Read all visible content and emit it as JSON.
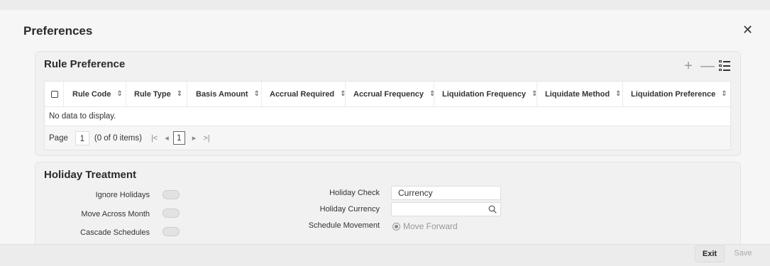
{
  "dialog": {
    "title": "Preferences",
    "close_glyph": "✕"
  },
  "rule_preference": {
    "title": "Rule Preference",
    "tools": {
      "add": "+",
      "remove": "—"
    },
    "columns": [
      "Rule Code",
      "Rule Type",
      "Basis Amount",
      "Accrual Required",
      "Accrual Frequency",
      "Liquidation Frequency",
      "Liquidate Method",
      "Liquidation Preference"
    ],
    "sort_glyph": "⇕",
    "no_data": "No data to display.",
    "pager": {
      "page_label": "Page",
      "page_value": "1",
      "count_text": "(0 of 0 items)",
      "first": "|<",
      "prev": "◂",
      "current": "1",
      "next": "▸",
      "last": ">|"
    }
  },
  "holiday_treatment": {
    "title": "Holiday Treatment",
    "ignore_holidays": "Ignore Holidays",
    "move_across_month": "Move Across Month",
    "cascade_schedules": "Cascade Schedules",
    "holiday_check_label": "Holiday Check",
    "holiday_check_value": "Currency",
    "holiday_currency_label": "Holiday Currency",
    "holiday_currency_value": "",
    "schedule_movement_label": "Schedule Movement",
    "schedule_movement_option": "Move Forward"
  },
  "footer": {
    "exit": "Exit",
    "save": "Save"
  }
}
